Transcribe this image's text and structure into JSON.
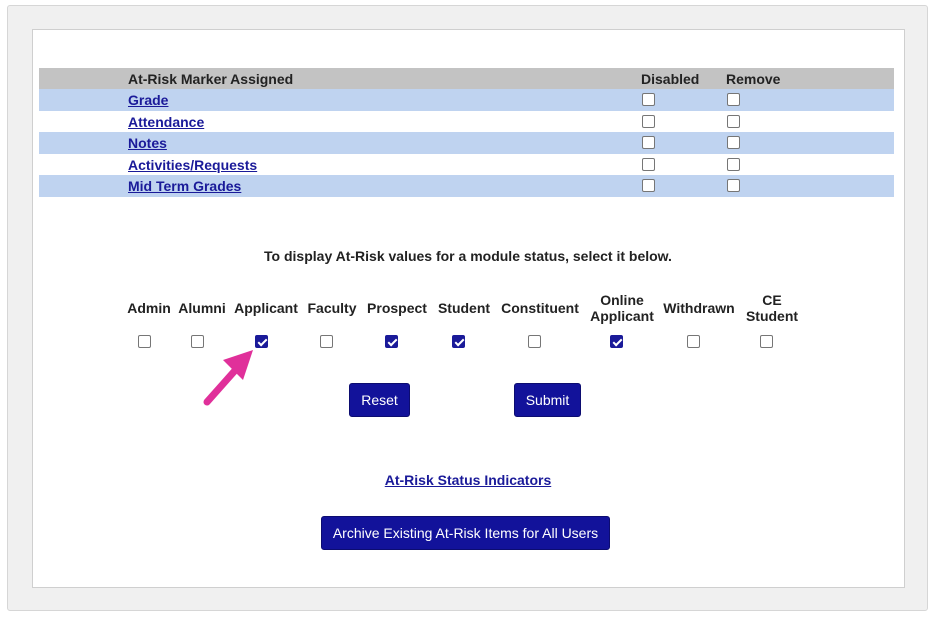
{
  "marker_table": {
    "header": {
      "marker": "At-Risk Marker Assigned",
      "disabled": "Disabled",
      "remove": "Remove"
    },
    "rows": [
      {
        "label": "Grade",
        "disabled": false,
        "remove": false
      },
      {
        "label": "Attendance",
        "disabled": false,
        "remove": false
      },
      {
        "label": "Notes",
        "disabled": false,
        "remove": false
      },
      {
        "label": "Activities/Requests",
        "disabled": false,
        "remove": false
      },
      {
        "label": "Mid Term Grades",
        "disabled": false,
        "remove": false
      }
    ]
  },
  "instructions": "To display At-Risk values for a module status, select it below.",
  "statuses": [
    {
      "line1": "Admin",
      "line2": "",
      "checked": false
    },
    {
      "line1": "Alumni",
      "line2": "",
      "checked": false
    },
    {
      "line1": "Applicant",
      "line2": "",
      "checked": true
    },
    {
      "line1": "Faculty",
      "line2": "",
      "checked": false
    },
    {
      "line1": "Prospect",
      "line2": "",
      "checked": true
    },
    {
      "line1": "Student",
      "line2": "",
      "checked": true
    },
    {
      "line1": "Constituent",
      "line2": "",
      "checked": false
    },
    {
      "line1": "Online",
      "line2": "Applicant",
      "checked": true
    },
    {
      "line1": "Withdrawn",
      "line2": "",
      "checked": false
    },
    {
      "line1": "CE",
      "line2": "Student",
      "checked": false
    }
  ],
  "buttons": {
    "reset": "Reset",
    "submit": "Submit",
    "archive": "Archive Existing At-Risk Items for All Users"
  },
  "link": "At-Risk Status Indicators",
  "colors": {
    "button": "#12129a",
    "row_blue": "#bfd3f0",
    "header_gray": "#c3c3c3",
    "arrow": "#e0309a",
    "link": "#1a1a99"
  }
}
